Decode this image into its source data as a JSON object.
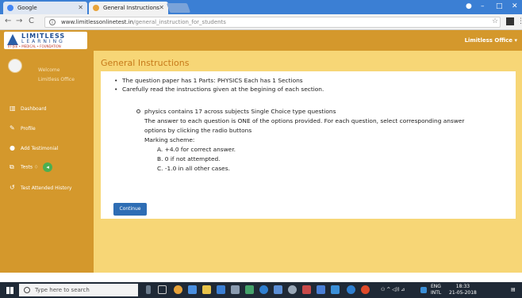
{
  "browser": {
    "tabs": [
      {
        "label": "Google",
        "active": false
      },
      {
        "label": "General Instructions",
        "active": true
      }
    ],
    "url_host": "www.limitlessonlinetest.in",
    "url_path": "/general_instruction_for_students"
  },
  "header": {
    "logo_line1": "LIMITLESS",
    "logo_line2": "LEARNING",
    "logo_tagline": "IIT-JEE • MEDICAL • FOUNDATION",
    "user_menu": "Limitless Office"
  },
  "sidebar": {
    "welcome": "Welcome",
    "username": "Limitless Office",
    "items": [
      {
        "label": "Dashboard",
        "icon": "bar-chart-icon"
      },
      {
        "label": "Profile",
        "icon": "edit-icon"
      },
      {
        "label": "Add Testimonial",
        "icon": "speech-bubble-icon"
      },
      {
        "label": "Tests",
        "icon": "tests-icon"
      },
      {
        "label": "Test Attended History",
        "icon": "history-icon"
      }
    ]
  },
  "main": {
    "title": "General Instructions",
    "bullets": [
      "The question paper has 1 Parts: PHYSICS Each has 1 Sections",
      "Carefully read the instructions given at the begining of each section."
    ],
    "section_line": "physics contains 17 across subjects Single Choice type questions",
    "answer_line1": "The answer to each question is ONE of the options provided. For each question, select corresponding answer",
    "answer_line2": "options by clicking the radio buttons",
    "marking_heading": "Marking scheme:",
    "marking": [
      "A. +4.0 for correct answer.",
      "B. 0 if not attempted.",
      "C. -1.0 in all other cases."
    ],
    "continue_label": "Continue"
  },
  "taskbar": {
    "search_placeholder": "Type here to search",
    "lang_line1": "ENG",
    "lang_line2": "INTL",
    "time": "18:33",
    "date": "21-05-2018"
  },
  "colors": {
    "accent": "#d4982c",
    "main_bg": "#f7d676",
    "title": "#c77a1a",
    "button": "#2e6db4"
  }
}
